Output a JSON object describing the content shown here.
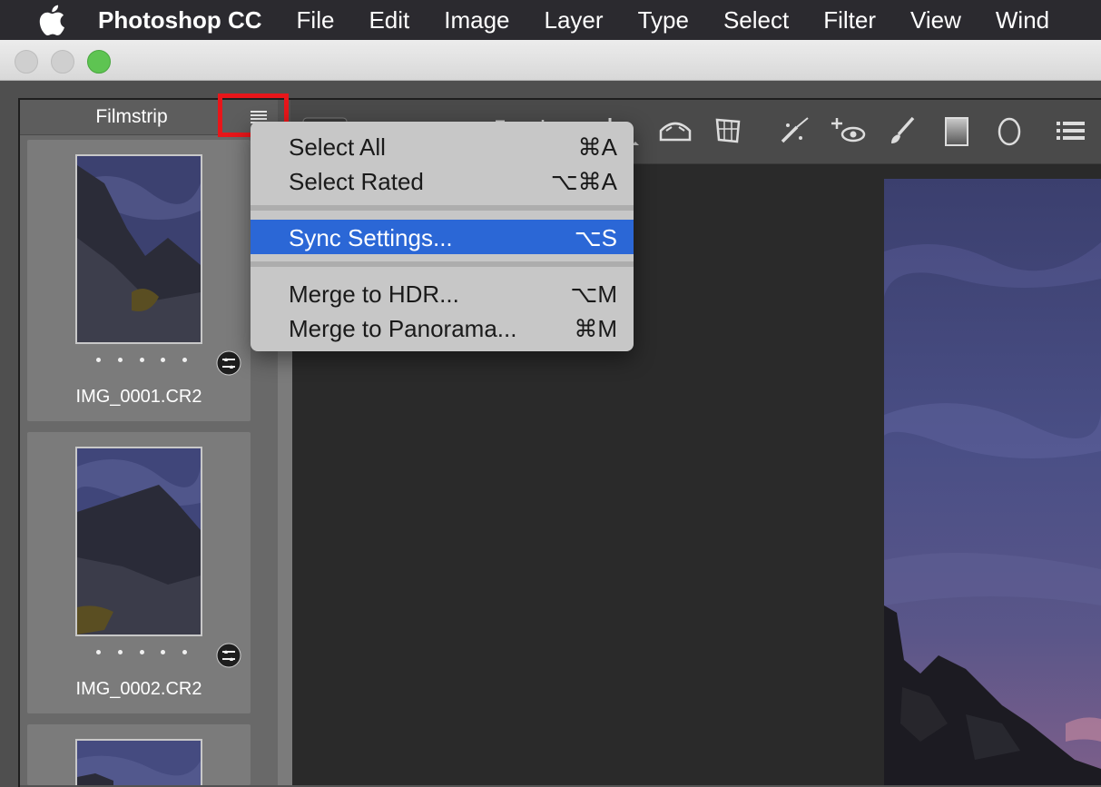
{
  "menubar": {
    "app_name": "Photoshop CC",
    "items": [
      "File",
      "Edit",
      "Image",
      "Layer",
      "Type",
      "Select",
      "Filter",
      "View",
      "Wind"
    ]
  },
  "filmstrip": {
    "title": "Filmstrip",
    "items": [
      {
        "filename": "IMG_0001.CR2",
        "rating": 0
      },
      {
        "filename": "IMG_0002.CR2",
        "rating": 0
      }
    ]
  },
  "context_menu": {
    "items": [
      {
        "label": "Select All",
        "shortcut": "⌘A"
      },
      {
        "label": "Select Rated",
        "shortcut": "⌥⌘A"
      },
      {
        "label": "Sync Settings...",
        "shortcut": "⌥S"
      },
      {
        "label": "Merge to HDR...",
        "shortcut": "⌥M"
      },
      {
        "label": "Merge to Panorama...",
        "shortcut": "⌘M"
      }
    ],
    "highlighted": "Sync Settings..."
  },
  "colors": {
    "highlight": "#2b67d6",
    "annotation": "#e8161a",
    "zoom_button": "#5ec452"
  }
}
